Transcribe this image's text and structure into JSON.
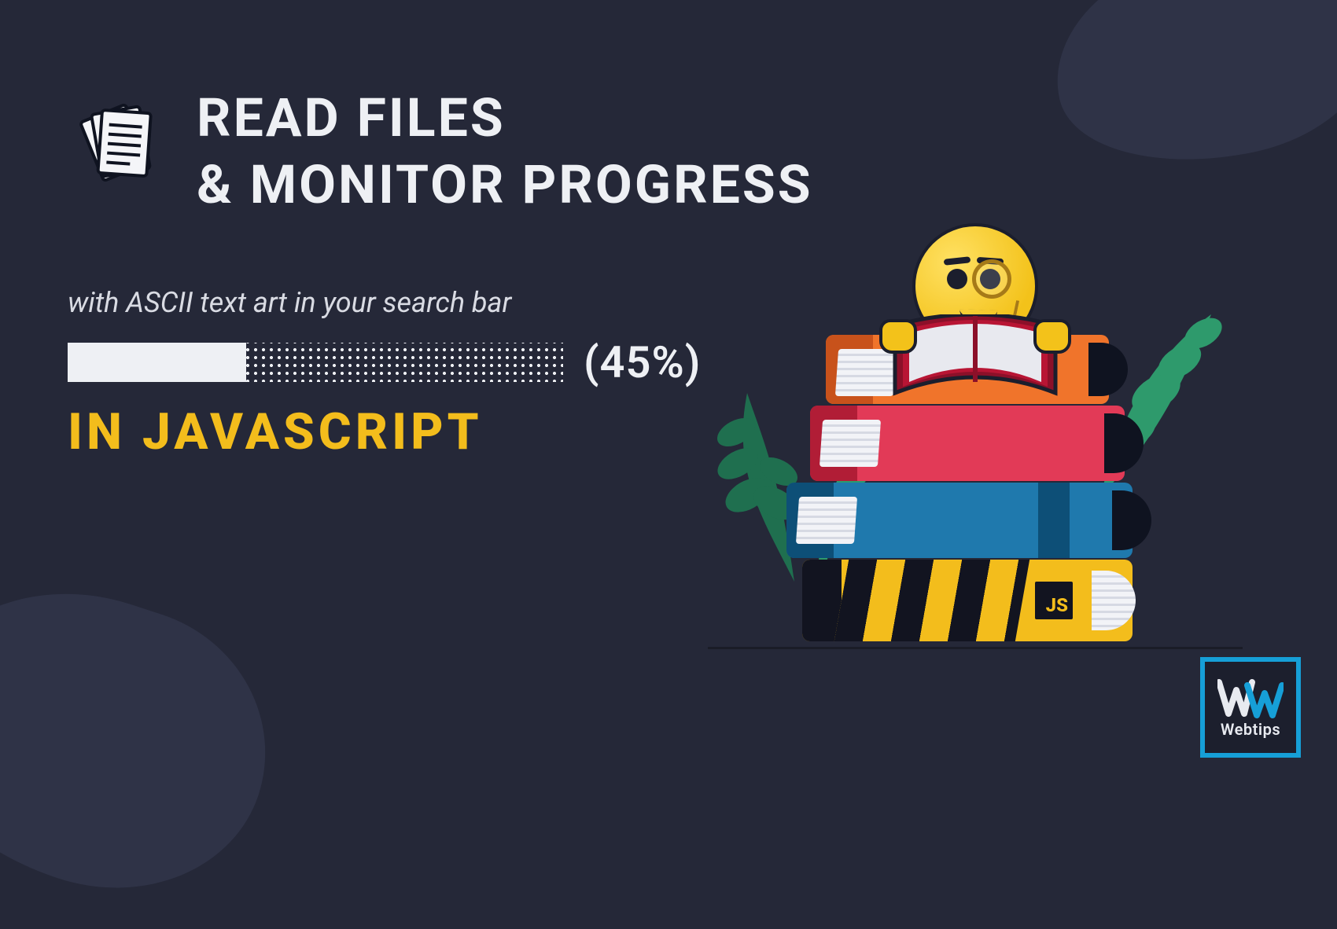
{
  "title_line1": "READ FILES",
  "title_line2": "& MONITOR PROGRESS",
  "subtitle": "with ASCII text art in your search bar",
  "progress": {
    "percent": 45,
    "label": "(45%)",
    "bar_fill_fraction": 0.36
  },
  "language_line": "IN JAVASCRIPT",
  "js_badge": "JS",
  "brand": {
    "name": "Webtips"
  },
  "colors": {
    "background": "#252838",
    "background_accent": "#2f3347",
    "text_light": "#eef0f4",
    "accent_yellow": "#f3bd1c",
    "brand_cyan": "#169fd7",
    "book_orange": "#f0742b",
    "book_red": "#e23a57",
    "book_blue": "#1f79ad",
    "book_dark": "#121420"
  }
}
